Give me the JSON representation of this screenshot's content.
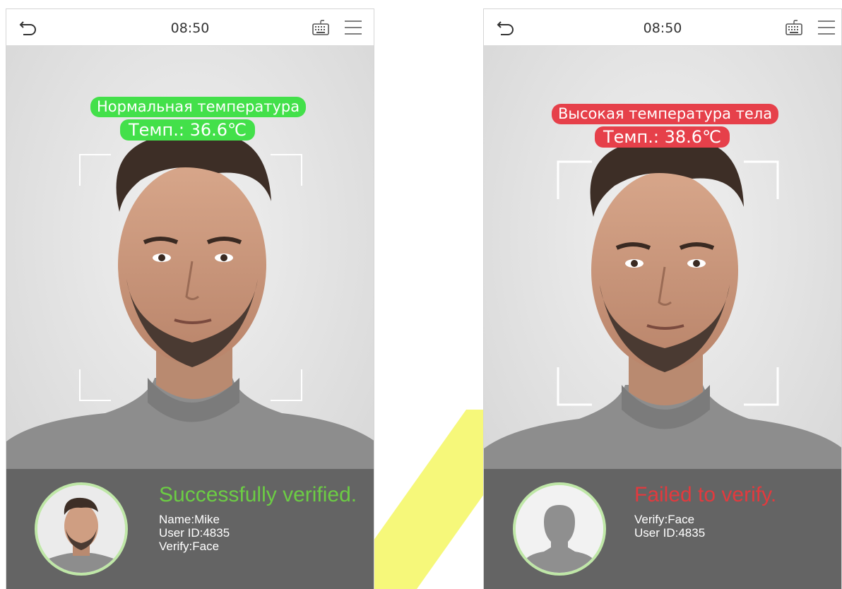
{
  "colors": {
    "accent_success": "#43e04a",
    "accent_fail": "#e6404a",
    "success_text": "#6ccd44",
    "fail_text": "#e23a3e",
    "watermark": "#eef30c"
  },
  "screens": [
    {
      "status_bar": {
        "time": "08:50",
        "icons": [
          "back-icon",
          "keyboard-icon",
          "menu-icon"
        ]
      },
      "temperature": {
        "status": "Нормальная температура",
        "reading": "Темп.: 36.6℃"
      },
      "result": {
        "title": "Successfully verified.",
        "lines": [
          "Name:Mike",
          "User ID:4835",
          "Verify:Face"
        ]
      }
    },
    {
      "status_bar": {
        "time": "08:50",
        "icons": [
          "back-icon",
          "keyboard-icon",
          "menu-icon"
        ]
      },
      "temperature": {
        "status": "Высокая температура тела",
        "reading": "Темп.: 38.6℃"
      },
      "result": {
        "title": "Failed to verify.",
        "lines": [
          "Verify:Face",
          "User ID:4835"
        ]
      }
    }
  ]
}
